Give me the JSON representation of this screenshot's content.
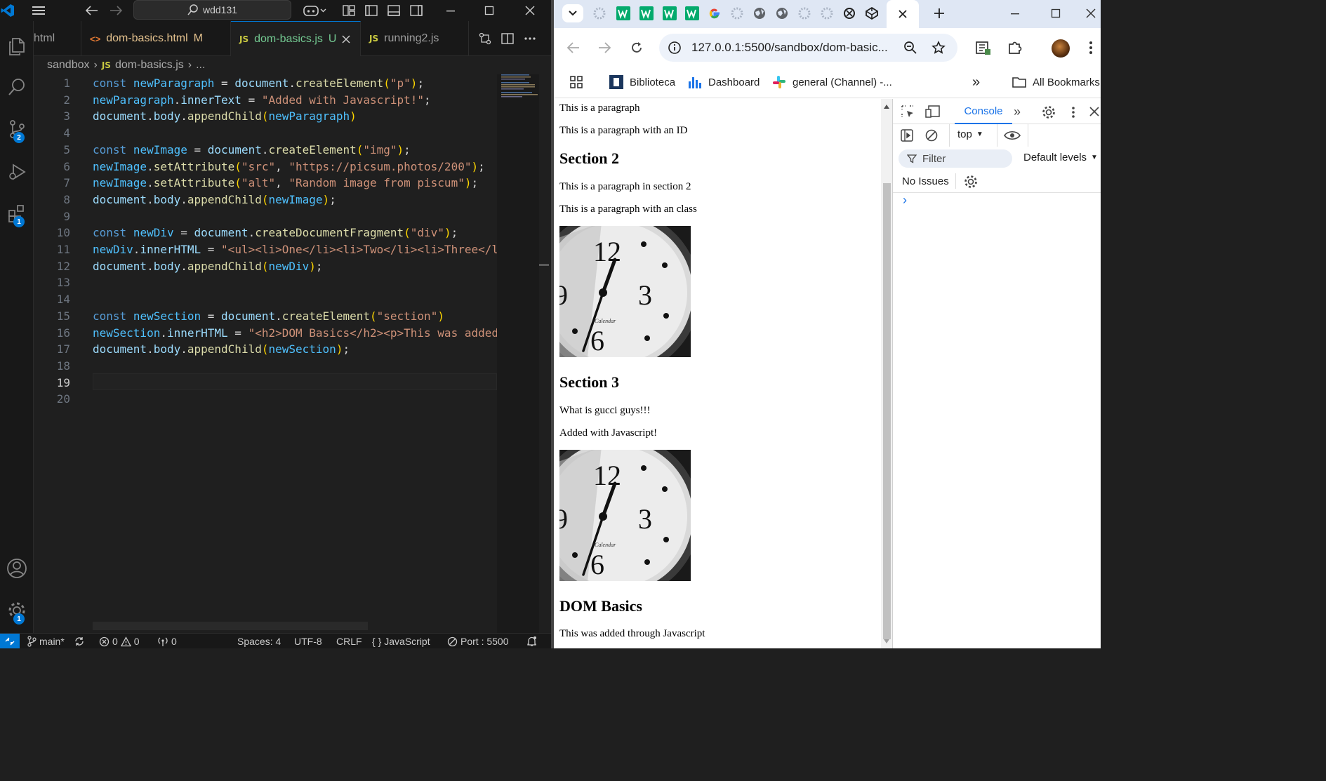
{
  "vscode": {
    "search_text": "wdd131",
    "tabs": [
      {
        "label": "html",
        "modified": ""
      },
      {
        "label": "dom-basics.html",
        "modified": "M"
      },
      {
        "label": "dom-basics.js",
        "modified": "U"
      },
      {
        "label": "running2.js",
        "modified": ""
      }
    ],
    "js_badge": "JS",
    "html_badge": "<>",
    "breadcrumb": {
      "folder": "sandbox",
      "file": "dom-basics.js",
      "more": "..."
    },
    "badges": {
      "source_control": "2",
      "extensions": "1",
      "settings": "1"
    },
    "code_lines": [
      "const newParagraph = document.createElement(\"p\");",
      "newParagraph.innerText = \"Added with Javascript!\";",
      "document.body.appendChild(newParagraph)",
      "",
      "const newImage = document.createElement(\"img\");",
      "newImage.setAttribute(\"src\", \"https://picsum.photos/200\");",
      "newImage.setAttribute(\"alt\", \"Random image from piscum\");",
      "document.body.appendChild(newImage);",
      "",
      "const newDiv = document.createDocumentFragment(\"div\");",
      "newDiv.innerHTML = \"<ul><li>One</li><li>Two</li><li>Three</li",
      "document.body.appendChild(newDiv);",
      "",
      "",
      "const newSection = document.createElement(\"section\")",
      "newSection.innerHTML = \"<h2>DOM Basics</h2><p>This was added",
      "document.body.appendChild(newSection);",
      "",
      "",
      ""
    ],
    "status": {
      "branch": "main*",
      "errors": "0",
      "warnings": "0",
      "ports": "0",
      "spaces": "Spaces: 4",
      "encoding": "UTF-8",
      "eol": "CRLF",
      "language": "JavaScript",
      "port": "Port : 5500"
    }
  },
  "chrome": {
    "url": "127.0.0.1:5500/sandbox/dom-basic...",
    "bookmarks": [
      {
        "label": "Biblioteca"
      },
      {
        "label": "Dashboard"
      },
      {
        "label": "general (Channel) -..."
      }
    ],
    "all_bookmarks": "All Bookmarks",
    "overflow": "»"
  },
  "page": {
    "p1": "This is a paragraph",
    "p2": "This is a paragraph with an ID",
    "h_section2": "Section 2",
    "p3": "This is a paragraph in section 2",
    "p4": "This is a paragraph with an class",
    "h_section3": "Section 3",
    "p5": "What is gucci guys!!!",
    "p6": "Added with Javascript!",
    "h_dom": "DOM Basics",
    "p7": "This was added through Javascript"
  },
  "devtools": {
    "console_tab": "Console",
    "context": "top",
    "filter_placeholder": "Filter",
    "levels": "Default levels",
    "issues": "No Issues",
    "prompt": "›"
  },
  "colors": {
    "accent": "#0078d4",
    "vs_bg": "#1f1f1f",
    "keyword": "#569cd6",
    "string": "#ce9178",
    "function": "#dcdcaa"
  }
}
